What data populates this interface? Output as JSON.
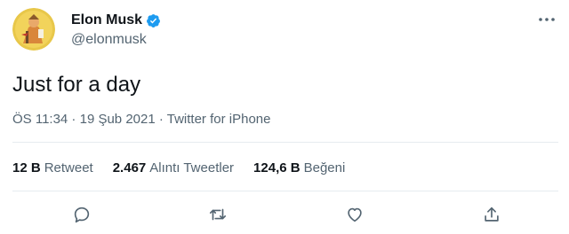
{
  "tweet": {
    "author": {
      "name": "Elon Musk",
      "handle": "@elonmusk",
      "verified_icon": "verified-badge-icon",
      "avatar_icon": "avatar-image"
    },
    "text": "Just for a day",
    "meta": {
      "time": "ÖS 11:34",
      "separator": " · ",
      "date": "19 Şub 2021",
      "source": "Twitter for iPhone"
    },
    "stats": [
      {
        "count": "12 B",
        "label": "Retweet"
      },
      {
        "count": "2.467",
        "label": "Alıntı Tweetler"
      },
      {
        "count": "124,6 B",
        "label": "Beğeni"
      }
    ],
    "actions": [
      "reply-icon",
      "retweet-icon",
      "like-icon",
      "share-icon"
    ]
  },
  "colors": {
    "accent": "#1d9bf0",
    "secondary_text": "#536471",
    "divider": "#e6ecf0"
  }
}
